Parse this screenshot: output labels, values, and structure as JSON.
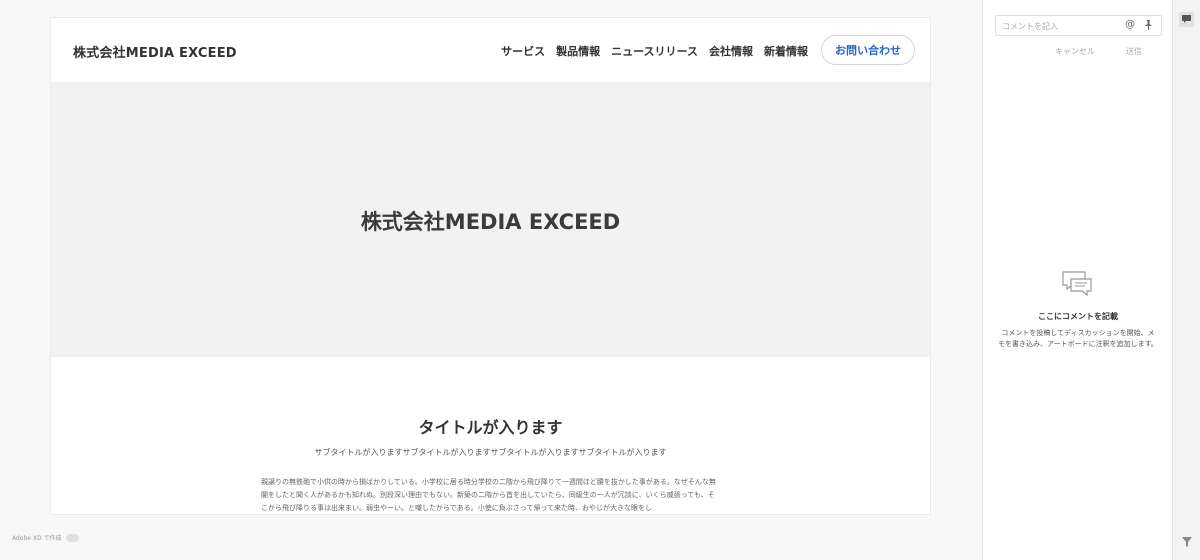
{
  "site": {
    "logo": "株式会社MEDIA EXCEED",
    "nav": [
      "サービス",
      "製品情報",
      "ニュースリリース",
      "会社情報",
      "新着情報"
    ],
    "contact_button": "お問い合わせ",
    "hero_title": "株式会社MEDIA EXCEED",
    "section_title": "タイトルが入ります",
    "section_subtitle": "サブタイトルが入りますサブタイトルが入りますサブタイトルが入りますサブタイトルが入ります",
    "body_text": "親譲りの無鉄砲で小供の時から損ばかりしている。小学校に居る時分学校の二階から飛び降りて一週間ほど腰を抜かした事がある。なぜそんな無闇をしたと聞く人があるかも知れぬ。別段深い理由でもない。新築の二階から首を出していたら、同級生の一人が冗談に、いくら威張っても、そこから飛び降りる事は出来まい。弱虫やーい。と囃したからである。小使に負ぶさって帰って来た時、おやじが大きな眼をし"
  },
  "footer": {
    "made_with": "Adobe XD で作成"
  },
  "comments": {
    "placeholder": "コメントを記入",
    "cancel": "キャンセル",
    "send": "送信",
    "empty_title": "ここにコメントを記載",
    "empty_desc": "コメントを投稿してディスカッションを開始、メモを書き込み、アートボードに注釈を追加します。"
  },
  "colors": {
    "accent": "#2a66c9",
    "hero_bg": "#f2f2f2"
  },
  "icons": [
    "at-icon",
    "pin-icon",
    "comment-bubble-icon",
    "filter-icon"
  ]
}
